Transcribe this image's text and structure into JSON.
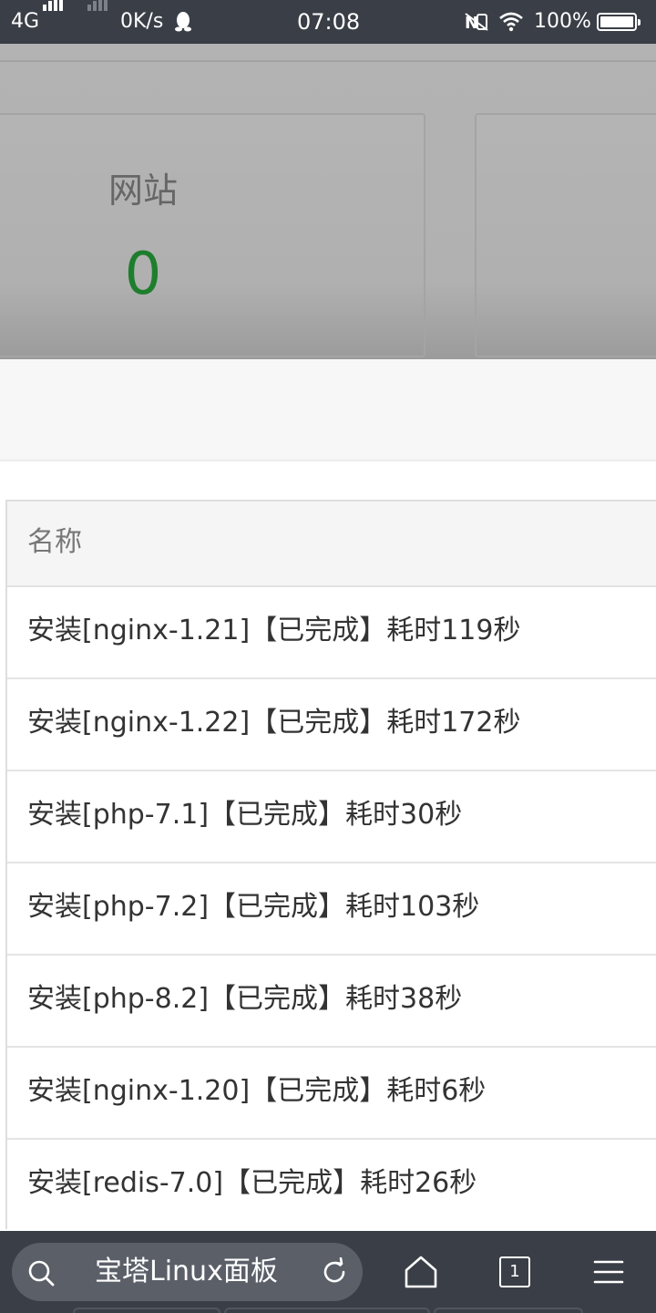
{
  "status_bar": {
    "network": "4G",
    "speed": "0K/s",
    "time": "07:08",
    "battery": "100%"
  },
  "overview": {
    "card_label": "网站",
    "card_value": "0",
    "value_color": "#1e7e2d"
  },
  "table": {
    "header": "名称",
    "rows": [
      "安装[nginx-1.21]【已完成】耗时119秒",
      "安装[nginx-1.22]【已完成】耗时172秒",
      "安装[php-7.1]【已完成】耗时30秒",
      "安装[php-7.2]【已完成】耗时103秒",
      "安装[php-8.2]【已完成】耗时38秒",
      "安装[nginx-1.20]【已完成】耗时6秒",
      "安装[redis-7.0]【已完成】耗时26秒"
    ]
  },
  "browser_bar": {
    "query": "宝塔Linux面板",
    "tab_count": "1",
    "icons": [
      "search-icon",
      "refresh-icon",
      "home-icon",
      "tabs-icon",
      "menu-icon"
    ]
  }
}
